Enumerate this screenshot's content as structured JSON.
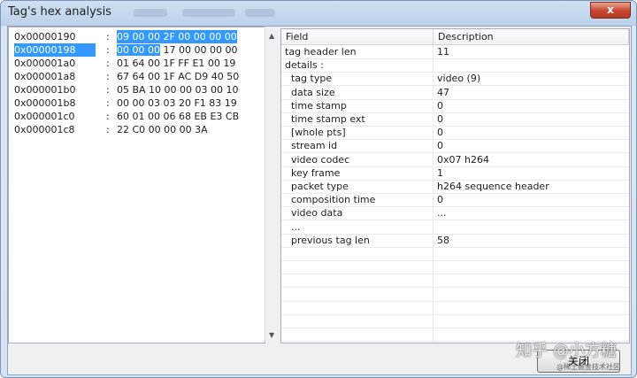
{
  "window": {
    "title": "Tag's hex analysis",
    "close_label": "x"
  },
  "hex": {
    "rows": [
      {
        "addr": "0x00000190",
        "colon": ":",
        "bytes_sel": "09 00 00 2F 00 00 00 00",
        "bytes": ""
      },
      {
        "addr": "0x00000198",
        "colon": ":",
        "bytes_sel": "00 00 00",
        "bytes": "17 00 00 00 00"
      },
      {
        "addr": "0x000001a0",
        "colon": ":",
        "bytes_sel": "",
        "bytes": "01 64 00 1F FF E1 00 19"
      },
      {
        "addr": "0x000001a8",
        "colon": ":",
        "bytes_sel": "",
        "bytes": "67 64 00 1F AC D9 40 50"
      },
      {
        "addr": "0x000001b0",
        "colon": ":",
        "bytes_sel": "",
        "bytes": "05 BA 10 00 00 03 00 10"
      },
      {
        "addr": "0x000001b8",
        "colon": ":",
        "bytes_sel": "",
        "bytes": "00 00 03 03 20 F1 83 19"
      },
      {
        "addr": "0x000001c0",
        "colon": ":",
        "bytes_sel": "",
        "bytes": "60 01 00 06 68 EB E3 CB"
      },
      {
        "addr": "0x000001c8",
        "colon": ":",
        "bytes_sel": "",
        "bytes": "22 C0 00 00 00 3A"
      }
    ]
  },
  "table": {
    "headers": [
      "Field",
      "Description"
    ],
    "rows": [
      {
        "field": "tag header len",
        "desc": "11"
      },
      {
        "field": "details :",
        "desc": ""
      },
      {
        "field": "  tag type",
        "desc": "video (9)"
      },
      {
        "field": "  data size",
        "desc": "47"
      },
      {
        "field": "  time stamp",
        "desc": "0"
      },
      {
        "field": "  time stamp ext",
        "desc": "0"
      },
      {
        "field": "  [whole pts]",
        "desc": "0"
      },
      {
        "field": "  stream id",
        "desc": "0"
      },
      {
        "field": "  video codec",
        "desc": "0x07  h264"
      },
      {
        "field": "  key frame",
        "desc": "1"
      },
      {
        "field": "  packet type",
        "desc": "h264 sequence header"
      },
      {
        "field": "  composition time",
        "desc": "0"
      },
      {
        "field": "  video data",
        "desc": "..."
      },
      {
        "field": "  ...",
        "desc": ""
      },
      {
        "field": "  previous tag len",
        "desc": "58"
      }
    ]
  },
  "buttons": {
    "close": "关闭"
  },
  "watermark": {
    "main": "知乎 @小方糖",
    "sub": "@稀土掘金技术社区"
  }
}
